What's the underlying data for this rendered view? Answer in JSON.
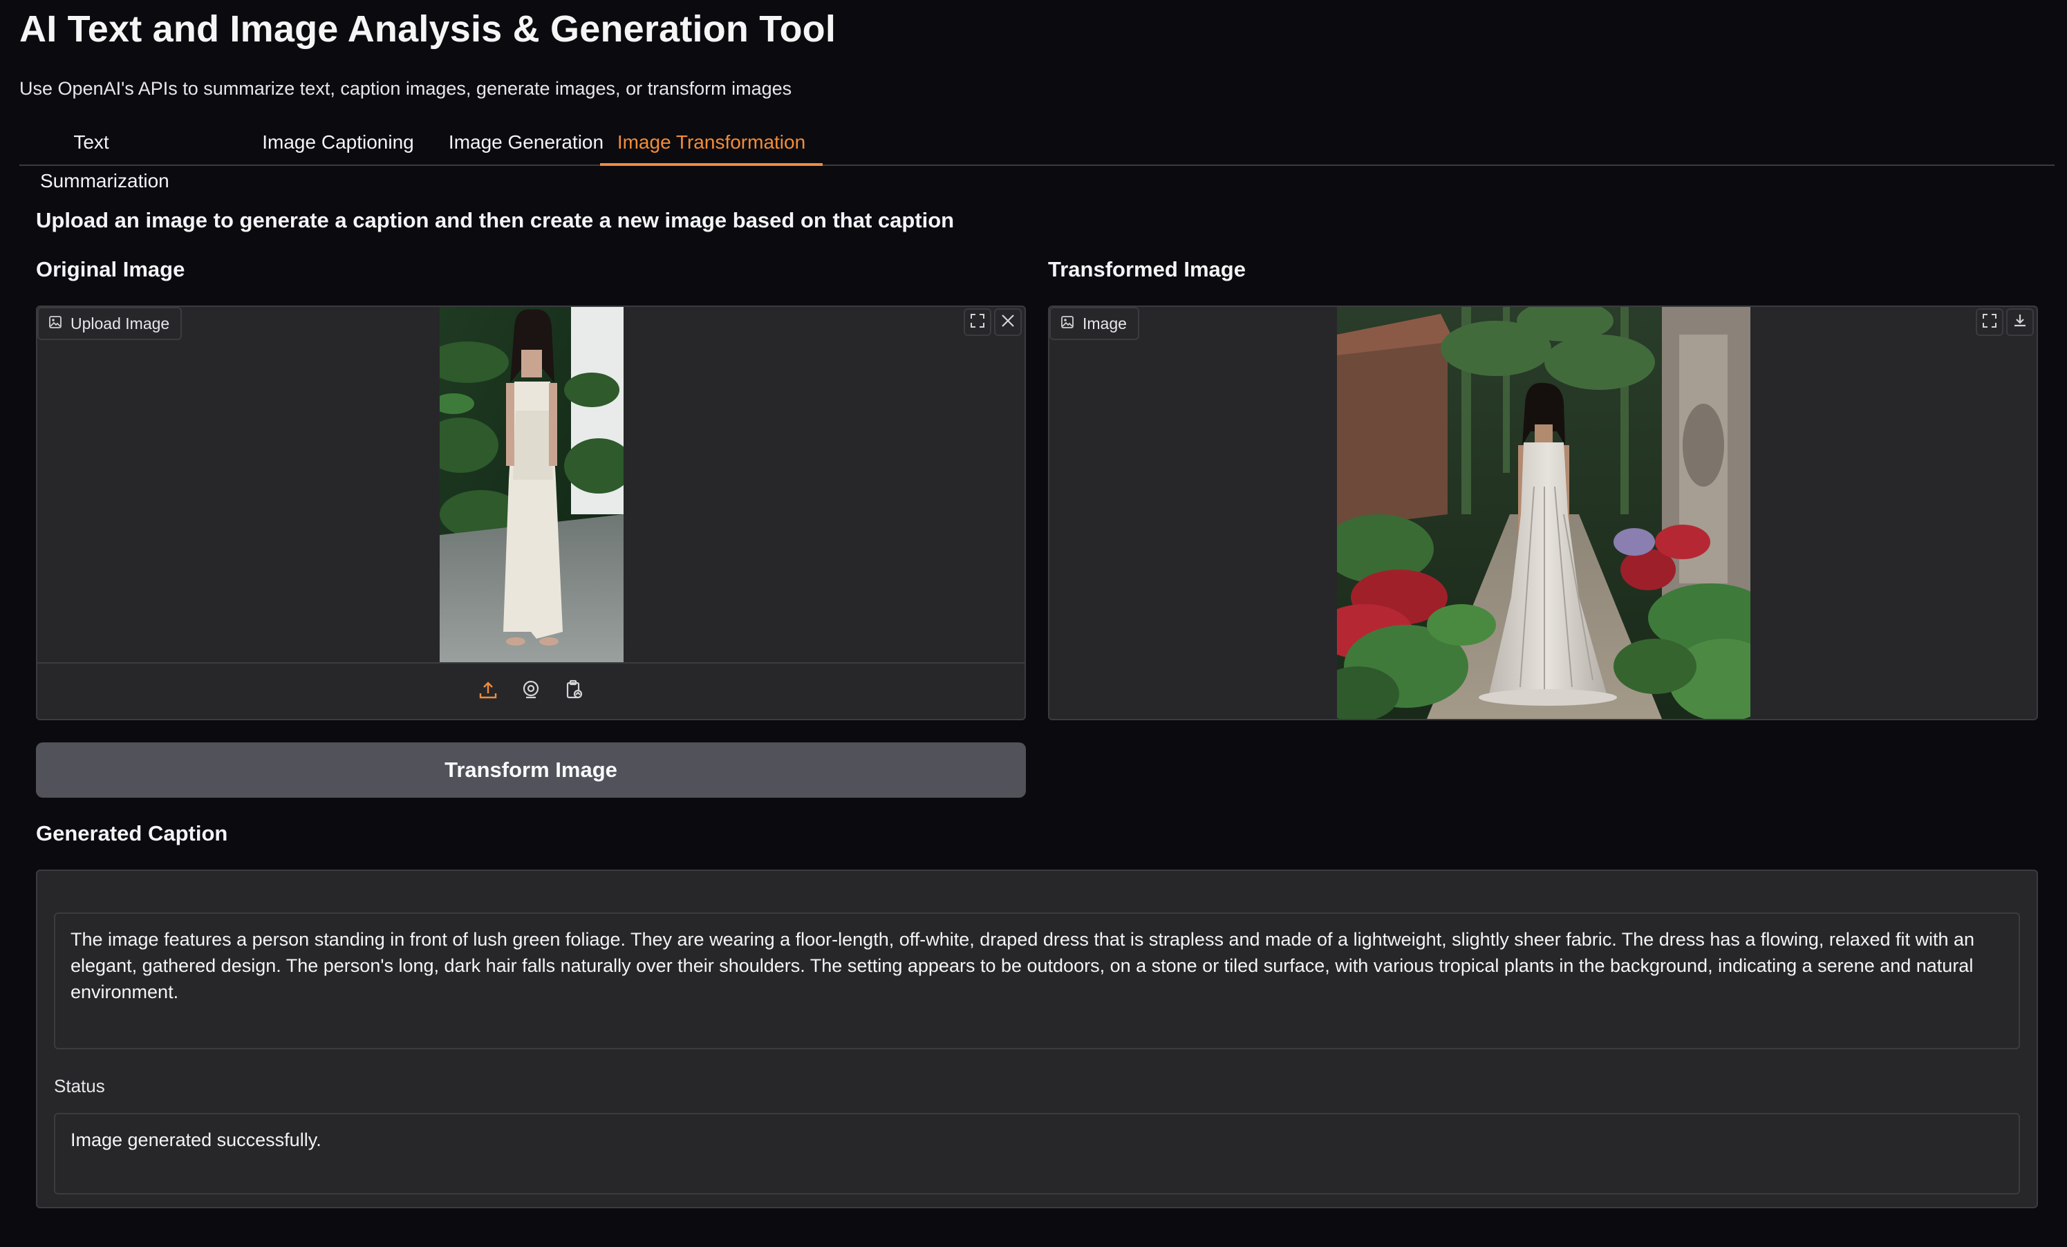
{
  "app": {
    "title": "AI Text and Image Analysis & Generation Tool",
    "description": "Use OpenAI's APIs to summarize text, caption images, generate images, or transform images"
  },
  "tabs": [
    {
      "label": "Text Summarization",
      "active": false
    },
    {
      "label": "Image Captioning",
      "active": false
    },
    {
      "label": "Image Generation",
      "active": false
    },
    {
      "label": "Image Transformation",
      "active": true
    }
  ],
  "main": {
    "instruction": "Upload an image to generate a caption and then create a new image based on that caption",
    "original": {
      "label": "Original Image",
      "badge": "Upload Image",
      "icons": [
        "image-icon",
        "fullscreen-icon",
        "close-icon",
        "upload-icon",
        "webcam-icon",
        "clipboard-icon"
      ]
    },
    "transformed": {
      "label": "Transformed Image",
      "badge": "Image",
      "icons": [
        "image-icon",
        "fullscreen-icon",
        "download-icon"
      ]
    },
    "transform_button": "Transform Image",
    "caption": {
      "label": "Generated Caption",
      "text": "The image features a person standing in front of lush green foliage. They are wearing a floor-length, off-white, draped dress that is strapless and made of a lightweight, slightly sheer fabric. The dress has a flowing, relaxed fit with an elegant, gathered design. The person's long, dark hair falls naturally over their shoulders. The setting appears to be outdoors, on a stone or tiled surface, with various tropical plants in the background, indicating a serene and natural environment."
    },
    "status": {
      "label": "Status",
      "text": "Image generated successfully."
    }
  },
  "colors": {
    "background": "#0b0b0f",
    "panel": "#27272a",
    "border": "#3b3b40",
    "accent": "#f28c3a",
    "button": "#52525b"
  }
}
